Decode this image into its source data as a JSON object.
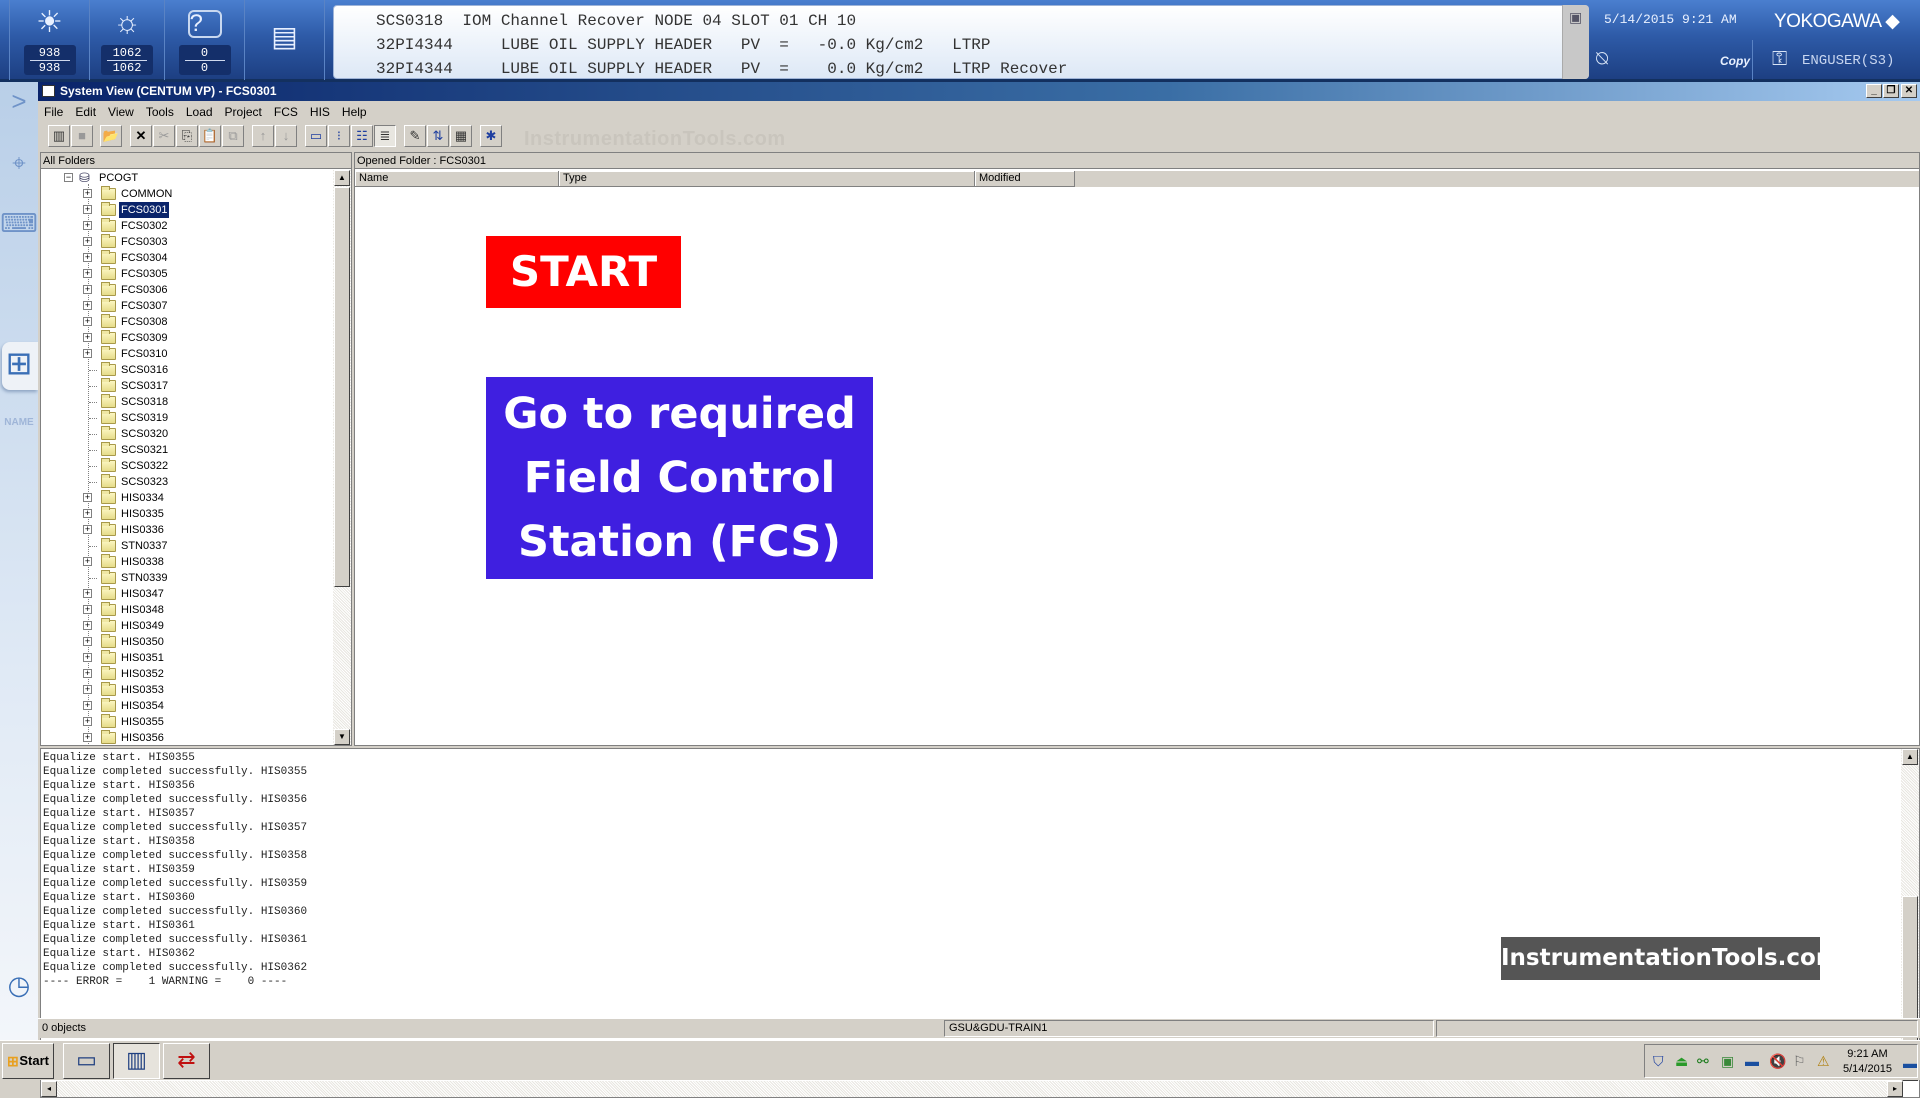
{
  "header": {
    "counters": [
      {
        "icon": "process-alarm-icon",
        "top": "938",
        "bottom": "938"
      },
      {
        "icon": "system-alarm-icon",
        "top": "1062",
        "bottom": "1062"
      },
      {
        "icon": "operator-guide-icon",
        "top": "0",
        "bottom": "0"
      }
    ],
    "message_icon": "message-monitor-icon",
    "alarm_banner": [
      "SCS0318  IOM Channel Recover NODE 04 SLOT 01 CH 10",
      "32PI4344     LUBE OIL SUPPLY HEADER   PV  =   -0.0 Kg/cm2   LTRP",
      "32PI4344     LUBE OIL SUPPLY HEADER   PV  =    0.0 Kg/cm2   LTRP Recover"
    ],
    "datetime": "5/14/2015 9:21 AM",
    "brand": "YOKOGAWA",
    "copy_label": "Copy",
    "user": "ENGUSER(S3)"
  },
  "sidebar": {
    "items": [
      {
        "name": "expand-arrow-icon",
        "glyph": ">"
      },
      {
        "name": "navigator-icon",
        "glyph": "⌖"
      },
      {
        "name": "keyboard-icon",
        "glyph": "⌨"
      },
      {
        "name": "panel-view-icon",
        "glyph": "⊞"
      },
      {
        "name": "name-input-label",
        "glyph": "NAME"
      },
      {
        "name": "history-icon",
        "glyph": "◷"
      }
    ]
  },
  "window": {
    "title": "System View (CENTUM VP) - FCS0301",
    "controls": {
      "minimize": "_",
      "restore": "❐",
      "close": "✕"
    },
    "menu": [
      "File",
      "Edit",
      "View",
      "Tools",
      "Load",
      "Project",
      "FCS",
      "HIS",
      "Help"
    ],
    "toolbar": [
      {
        "name": "properties-icon",
        "glyph": "▥",
        "enabled": true
      },
      {
        "name": "stop-icon",
        "glyph": "■",
        "enabled": false
      },
      {
        "name": "open-icon",
        "glyph": "📂",
        "enabled": true
      },
      {
        "name": "delete-icon",
        "glyph": "✕",
        "enabled": true
      },
      {
        "name": "cut-icon",
        "glyph": "✂",
        "enabled": false
      },
      {
        "name": "copy-icon",
        "glyph": "⎘",
        "enabled": true
      },
      {
        "name": "paste-icon",
        "glyph": "📋",
        "enabled": false
      },
      {
        "name": "paste-special-icon",
        "glyph": "⧉",
        "enabled": false
      },
      {
        "name": "move-up-icon",
        "glyph": "↑",
        "enabled": false
      },
      {
        "name": "move-down-icon",
        "glyph": "↓",
        "enabled": false
      },
      {
        "name": "large-icons-icon",
        "glyph": "▭",
        "enabled": true
      },
      {
        "name": "small-icons-icon",
        "glyph": "⁝",
        "enabled": true
      },
      {
        "name": "list-view-icon",
        "glyph": "☷",
        "enabled": true
      },
      {
        "name": "details-view-icon",
        "glyph": "≣",
        "enabled": true
      },
      {
        "name": "edit-properties-icon",
        "glyph": "✎",
        "enabled": true
      },
      {
        "name": "sort-az-icon",
        "glyph": "⇅",
        "enabled": true
      },
      {
        "name": "calendar-icon",
        "glyph": "▦",
        "enabled": true
      },
      {
        "name": "tools-icon",
        "glyph": "✱",
        "enabled": true
      }
    ],
    "toolbar_watermark": "InstrumentationTools.com"
  },
  "tree": {
    "header": "All Folders",
    "root": "PCOGT",
    "items": [
      {
        "label": "COMMON",
        "expandable": true,
        "selected": false
      },
      {
        "label": "FCS0301",
        "expandable": true,
        "selected": true
      },
      {
        "label": "FCS0302",
        "expandable": true,
        "selected": false
      },
      {
        "label": "FCS0303",
        "expandable": true,
        "selected": false
      },
      {
        "label": "FCS0304",
        "expandable": true,
        "selected": false
      },
      {
        "label": "FCS0305",
        "expandable": true,
        "selected": false
      },
      {
        "label": "FCS0306",
        "expandable": true,
        "selected": false
      },
      {
        "label": "FCS0307",
        "expandable": true,
        "selected": false
      },
      {
        "label": "FCS0308",
        "expandable": true,
        "selected": false
      },
      {
        "label": "FCS0309",
        "expandable": true,
        "selected": false
      },
      {
        "label": "FCS0310",
        "expandable": true,
        "selected": false
      },
      {
        "label": "SCS0316",
        "expandable": false,
        "selected": false
      },
      {
        "label": "SCS0317",
        "expandable": false,
        "selected": false
      },
      {
        "label": "SCS0318",
        "expandable": false,
        "selected": false
      },
      {
        "label": "SCS0319",
        "expandable": false,
        "selected": false
      },
      {
        "label": "SCS0320",
        "expandable": false,
        "selected": false
      },
      {
        "label": "SCS0321",
        "expandable": false,
        "selected": false
      },
      {
        "label": "SCS0322",
        "expandable": false,
        "selected": false
      },
      {
        "label": "SCS0323",
        "expandable": false,
        "selected": false
      },
      {
        "label": "HIS0334",
        "expandable": true,
        "selected": false
      },
      {
        "label": "HIS0335",
        "expandable": true,
        "selected": false
      },
      {
        "label": "HIS0336",
        "expandable": true,
        "selected": false
      },
      {
        "label": "STN0337",
        "expandable": false,
        "selected": false
      },
      {
        "label": "HIS0338",
        "expandable": true,
        "selected": false
      },
      {
        "label": "STN0339",
        "expandable": false,
        "selected": false
      },
      {
        "label": "HIS0347",
        "expandable": true,
        "selected": false
      },
      {
        "label": "HIS0348",
        "expandable": true,
        "selected": false
      },
      {
        "label": "HIS0349",
        "expandable": true,
        "selected": false
      },
      {
        "label": "HIS0350",
        "expandable": true,
        "selected": false
      },
      {
        "label": "HIS0351",
        "expandable": true,
        "selected": false
      },
      {
        "label": "HIS0352",
        "expandable": true,
        "selected": false
      },
      {
        "label": "HIS0353",
        "expandable": true,
        "selected": false
      },
      {
        "label": "HIS0354",
        "expandable": true,
        "selected": false
      },
      {
        "label": "HIS0355",
        "expandable": true,
        "selected": false
      },
      {
        "label": "HIS0356",
        "expandable": true,
        "selected": false
      }
    ]
  },
  "list": {
    "opened_folder": "Opened Folder : FCS0301",
    "columns": [
      "Name",
      "Type",
      "Modified"
    ]
  },
  "annotations": {
    "start": "START",
    "instruction_lines": [
      "Go to required",
      "Field Control",
      "Station (FCS)"
    ],
    "brand": "InstrumentationTools.com",
    "colors": {
      "start_bg": "#ff0000",
      "instruction_bg": "#3f1fe0",
      "brand_bg": "#555555"
    }
  },
  "log": {
    "lines": [
      "Equalize start. HIS0355",
      "Equalize completed successfully. HIS0355",
      "Equalize start. HIS0356",
      "Equalize completed successfully. HIS0356",
      "Equalize start. HIS0357",
      "Equalize completed successfully. HIS0357",
      "Equalize start. HIS0358",
      "Equalize completed successfully. HIS0358",
      "Equalize start. HIS0359",
      "Equalize completed successfully. HIS0359",
      "Equalize start. HIS0360",
      "Equalize completed successfully. HIS0360",
      "Equalize start. HIS0361",
      "Equalize completed successfully. HIS0361",
      "Equalize start. HIS0362",
      "Equalize completed successfully. HIS0362",
      "---- ERROR =    1 WARNING =    0 ----"
    ]
  },
  "statusbar": {
    "objects": "0 objects",
    "project": "GSU&GDU-TRAIN1"
  },
  "taskbar": {
    "start_label": "Start",
    "tasks": [
      {
        "name": "his-window-task",
        "glyph": "▭",
        "active": false
      },
      {
        "name": "system-view-task",
        "glyph": "▥",
        "active": true
      },
      {
        "name": "equalize-task",
        "glyph": "⇄",
        "active": false
      }
    ],
    "tray_icons": [
      "antivirus-shield-icon",
      "usb-safe-icon",
      "network-icon",
      "remote-icon",
      "display-icon",
      "volume-muted-icon",
      "action-center-flag-icon",
      "power-warning-icon"
    ],
    "clock_time": "9:21 AM",
    "clock_date": "5/14/2015"
  }
}
